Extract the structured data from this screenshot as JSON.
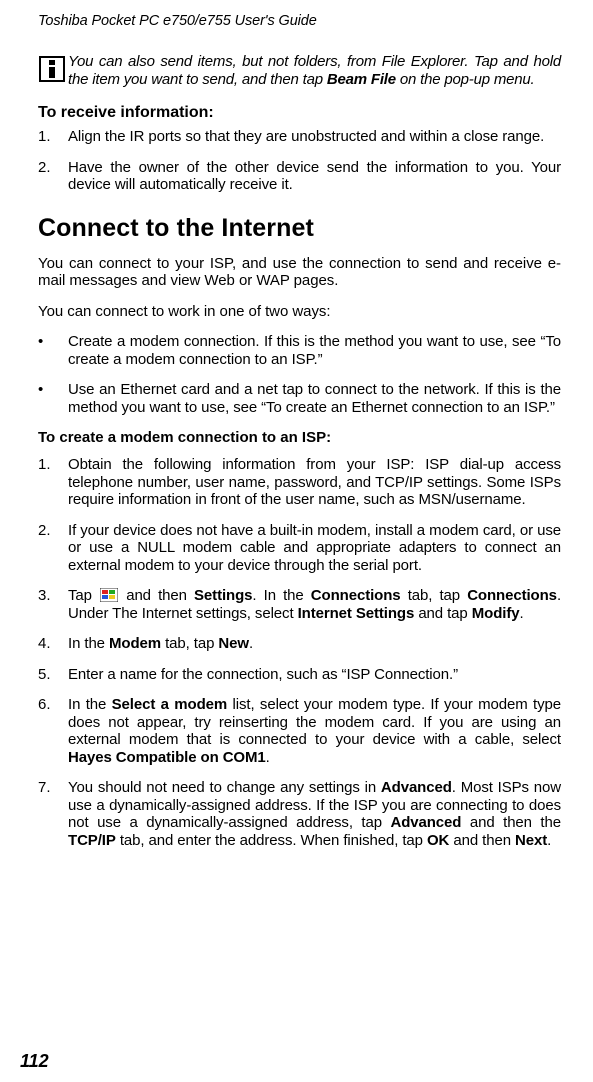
{
  "running_head": "Toshiba Pocket PC e750/e755  User's Guide",
  "note": {
    "pre": "You can also send items, but not folders, from File Explorer. Tap and hold the item you want to send, and then tap  ",
    "bold": "Beam File",
    "post": "  on the pop-up menu."
  },
  "receive": {
    "heading": "To receive information:",
    "items": [
      "Align the IR ports so that they are unobstructed and within a close range.",
      "Have the owner of the other device send the information to you. Your device will automatically receive it."
    ]
  },
  "connect": {
    "heading": "Connect  to the Internet",
    "p1": "You can connect to your ISP, and use the connection to send and receive e-mail messages and view Web or WAP pages.",
    "p2": "You can connect to work in one of two ways:",
    "bullets": [
      "Create a modem connection. If this is the method you want to use, see “To create a modem connection to an ISP.”",
      "Use an Ethernet card and a net tap to connect to the network. If this is the method you want to use, see  “To create an Ethernet connection to an ISP.”"
    ],
    "subhead": "To create a modem connection to an ISP:",
    "steps": {
      "1": "Obtain the following information from your ISP: ISP dial-up access telephone number, user name, password, and TCP/IP settings. Some ISPs require information in front of the user name, such as  MSN/username.",
      "2": "If your device does not have a built-in modem, install a modem card, or use or use a NULL modem cable and appropriate adapters to connect an external modem to your device through the serial port.",
      "3": {
        "a": "Tap ",
        "b": " and then ",
        "settings": "Settings",
        "c": ". In the ",
        "connections_tab": "Connections",
        "d": " tab, tap ",
        "connections": "Connections",
        "e": ". Under The Internet settings, select ",
        "internet_settings": "Internet Settings",
        "f": " and tap ",
        "modify": "Modify",
        "g": "."
      },
      "4": {
        "a": "In the ",
        "modem": "Modem",
        "b": "  tab, tap  ",
        "new": "New",
        "c": "."
      },
      "5": "Enter a name for the connection, such as “ISP Connection.”",
      "6": {
        "a": "In the ",
        "select_modem": "Select a modem",
        "b": " list, select your modem type. If your modem type does not appear, try reinserting the modem card. If you are using an external modem that is connected to your device with a cable, select  ",
        "hayes": "Hayes Compatible on COM1",
        "c": "."
      },
      "7": {
        "a": "You should not need to change any settings in  ",
        "advanced": "Advanced",
        "b": ". Most ISPs now use a dynamically-assigned address. If the ISP you are connecting to does not use a dynamically-assigned address, tap  ",
        "advanced2": "Advanced",
        "c": " and then the  ",
        "tcpip": "TCP/IP",
        "d": "  tab, and enter the address. When finished, tap ",
        "ok": "OK",
        "e": " and then  ",
        "next": "Next",
        "f": "."
      }
    }
  },
  "page_number": "112"
}
